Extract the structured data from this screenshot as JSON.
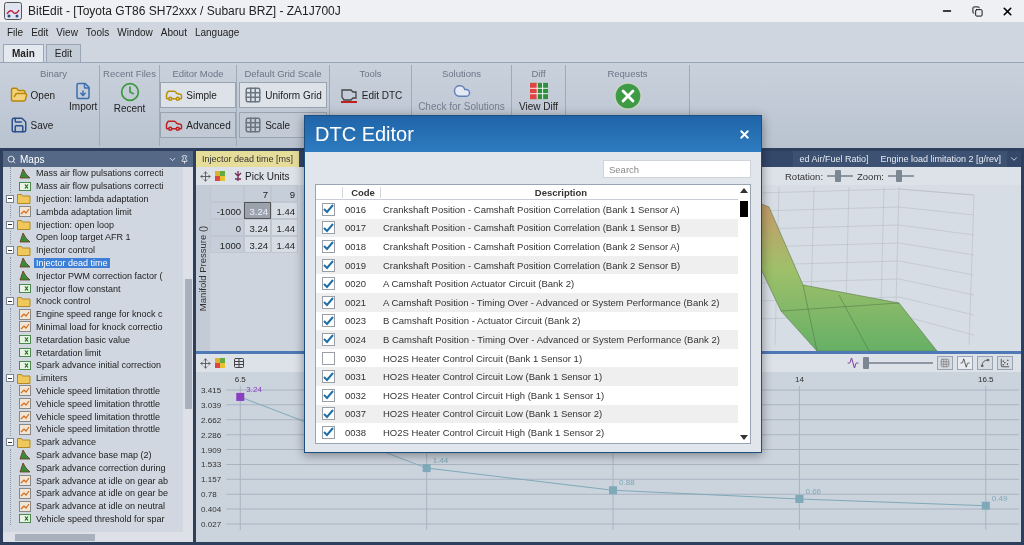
{
  "window": {
    "title": "BitEdit - [Toyota GT86 SH72xxx / Subaru BRZ] - ZA1J700J"
  },
  "menu": [
    "File",
    "Edit",
    "View",
    "Tools",
    "Window",
    "About",
    "Language"
  ],
  "ribbon_tabs": [
    {
      "label": "Main",
      "selected": true
    },
    {
      "label": "Edit",
      "selected": false
    }
  ],
  "ribbon_groups": [
    {
      "title": "Binary",
      "buttons": [
        {
          "kind": "row",
          "label": "Open",
          "disabled": false
        },
        {
          "kind": "row",
          "label": "Save",
          "disabled": false
        },
        {
          "kind": "large",
          "label": "Import",
          "disabled": false
        }
      ]
    },
    {
      "title": "Recent Files",
      "buttons": [
        {
          "kind": "large",
          "label": "Recent",
          "disabled": false
        }
      ]
    },
    {
      "title": "Editor Mode",
      "buttons": [
        {
          "kind": "toggle",
          "label": "Simple",
          "selected": true,
          "disabled": false
        },
        {
          "kind": "toggle",
          "label": "Advanced",
          "selected": false,
          "disabled": false
        }
      ]
    },
    {
      "title": "Default Grid Scale",
      "buttons": [
        {
          "kind": "toggle",
          "label": "Uniform Grid",
          "selected": true,
          "disabled": false
        },
        {
          "kind": "toggle",
          "label": "Scale",
          "selected": false,
          "disabled": false
        }
      ]
    },
    {
      "title": "Tools",
      "buttons": [
        {
          "kind": "row",
          "label": "Edit DTC",
          "disabled": false
        }
      ]
    },
    {
      "title": "Solutions",
      "buttons": [
        {
          "kind": "large",
          "label": "Check for Solutions",
          "disabled": true
        }
      ]
    },
    {
      "title": "Diff",
      "buttons": [
        {
          "kind": "large",
          "label": "View Diff",
          "disabled": false
        }
      ]
    },
    {
      "title": "Requests",
      "buttons": [
        {
          "kind": "large",
          "disabled": false
        }
      ]
    }
  ],
  "maps_panel": {
    "title": "Maps",
    "continued_items": [
      {
        "label": "Mass air flow pulsations correcti",
        "kind": "surface",
        "selected": false
      },
      {
        "label": "Mass air flow pulsations correcti",
        "kind": "value",
        "selected": false
      }
    ],
    "folders": [
      {
        "label": "Injection: lambda adaptation",
        "expanded": true,
        "children": [
          {
            "label": "Lambda adaptation limit",
            "kind": "table",
            "selected": false
          }
        ]
      },
      {
        "label": "Injection: open loop",
        "expanded": true,
        "children": [
          {
            "label": "Open loop target AFR 1",
            "kind": "surface",
            "selected": false
          }
        ]
      },
      {
        "label": "Injector control",
        "expanded": true,
        "children": [
          {
            "label": "Injector dead time",
            "kind": "surface",
            "selected": true
          },
          {
            "label": "Injector PWM correction factor (",
            "kind": "surface",
            "selected": false
          },
          {
            "label": "Injector flow constant",
            "kind": "value",
            "selected": false
          }
        ]
      },
      {
        "label": "Knock control",
        "expanded": true,
        "children": [
          {
            "label": "Engine speed range for knock c",
            "kind": "table",
            "selected": false
          },
          {
            "label": "Minimal load for knock correctio",
            "kind": "table",
            "selected": false
          },
          {
            "label": "Retardation basic value",
            "kind": "value",
            "selected": false
          },
          {
            "label": "Retardation limit",
            "kind": "value",
            "selected": false
          },
          {
            "label": "Spark advance initial correction",
            "kind": "value",
            "selected": false
          }
        ]
      },
      {
        "label": "Limiters",
        "expanded": true,
        "children": [
          {
            "label": "Vehicle speed limitation throttle",
            "kind": "table",
            "selected": false
          },
          {
            "label": "Vehicle speed limitation throttle",
            "kind": "table",
            "selected": false
          },
          {
            "label": "Vehicle speed limitation throttle",
            "kind": "table",
            "selected": false
          },
          {
            "label": "Vehicle speed limitation throttle",
            "kind": "table",
            "selected": false
          }
        ]
      },
      {
        "label": "Spark advance",
        "expanded": true,
        "children": [
          {
            "label": "Spark advance base map (2)",
            "kind": "surface",
            "selected": false
          },
          {
            "label": "Spark advance correction during",
            "kind": "surface",
            "selected": false
          },
          {
            "label": "Spark advance at idle on gear ab",
            "kind": "table",
            "selected": false
          },
          {
            "label": "Spark advance at idle on gear be",
            "kind": "table",
            "selected": false
          },
          {
            "label": "Spark advance at idle on neutral",
            "kind": "table",
            "selected": false
          },
          {
            "label": "Vehicle speed threshold for spar",
            "kind": "value",
            "selected": false
          }
        ]
      }
    ]
  },
  "doc_tabs": [
    {
      "label": "Injector dead time [ms]",
      "selected": true
    },
    {
      "label": "ed Air/Fuel Ratio]",
      "selected": false
    },
    {
      "label": "Engine load limitation 2 [g/rev]",
      "selected": false
    }
  ],
  "grid": {
    "pick_units": "Pick Units",
    "y_axis_label": "Manifold Pressure ()",
    "columns": [
      "7",
      "9"
    ],
    "rows": [
      {
        "header": "-1000",
        "cells": [
          {
            "value": "3.24",
            "selected": true
          },
          {
            "value": "1.44",
            "selected": false
          }
        ]
      },
      {
        "header": "0",
        "cells": [
          {
            "value": "3.24",
            "selected": false
          },
          {
            "value": "1.44",
            "selected": false
          }
        ]
      },
      {
        "header": "1000",
        "cells": [
          {
            "value": "3.24",
            "selected": false
          },
          {
            "value": "1.44",
            "selected": false
          }
        ]
      }
    ]
  },
  "surface_view": {
    "sliders": [
      {
        "label": "Rotation:",
        "level": 0.4
      },
      {
        "label": "Zoom:",
        "level": 0.4
      }
    ]
  },
  "curve_view": {
    "zoom_slider": {
      "level": 0
    },
    "chart_data": {
      "type": "line",
      "x": [
        6.5,
        9,
        11.5,
        14,
        16.5
      ],
      "series": [
        {
          "color": "#7fa9b8",
          "marker": "square",
          "values": [
            3.24,
            1.44,
            0.88,
            0.66,
            0.49
          ]
        }
      ],
      "xlim": [
        6.5,
        16.5
      ],
      "ylim": [
        0.027,
        3.415
      ],
      "xticks": [
        6.5,
        14,
        16.5
      ],
      "yticks": [
        3.415,
        3.039,
        2.662,
        2.286,
        1.909,
        1.533,
        1.157,
        0.78,
        0.404,
        0.027
      ],
      "grid": true,
      "data_labels": true
    }
  },
  "dtc_editor": {
    "title": "DTC Editor",
    "search": {
      "placeholder": "Search"
    },
    "columns": [
      "Code",
      "Description"
    ],
    "rows": [
      {
        "checked": true,
        "code": "0016",
        "description": "Crankshaft Position - Camshaft Position Correlation (Bank 1 Sensor A)"
      },
      {
        "checked": true,
        "code": "0017",
        "description": "Crankshaft Position - Camshaft Position Correlation (Bank 1 Sensor B)"
      },
      {
        "checked": true,
        "code": "0018",
        "description": "Crankshaft Position - Camshaft Position Correlation (Bank 2 Sensor A)"
      },
      {
        "checked": true,
        "code": "0019",
        "description": "Crankshaft Position - Camshaft Position Correlation (Bank 2 Sensor B)"
      },
      {
        "checked": true,
        "code": "0020",
        "description": "A Camshaft Position Actuator Circuit (Bank 2)"
      },
      {
        "checked": true,
        "code": "0021",
        "description": "A Camshaft Position - Timing Over - Advanced or System Performance (Bank 2)"
      },
      {
        "checked": true,
        "code": "0023",
        "description": "B Camshaft Position - Actuator Circuit (Bank 2)"
      },
      {
        "checked": true,
        "code": "0024",
        "description": "B Camshaft Position - Timing Over - Advanced or System Performance (Bank 2)"
      },
      {
        "checked": false,
        "code": "0030",
        "description": "HO2S Heater Control Circuit (Bank 1 Sensor 1)"
      },
      {
        "checked": true,
        "code": "0031",
        "description": "HO2S Heater Control Circuit Low (Bank 1 Sensor 1)"
      },
      {
        "checked": true,
        "code": "0032",
        "description": "HO2S Heater Control Circuit High (Bank 1 Sensor 1)"
      },
      {
        "checked": true,
        "code": "0037",
        "description": "HO2S Heater Control Circuit Low (Bank 1 Sensor 2)"
      },
      {
        "checked": true,
        "code": "0038",
        "description": "HO2S Heater Control Circuit High (Bank 1 Sensor 2)"
      }
    ]
  }
}
